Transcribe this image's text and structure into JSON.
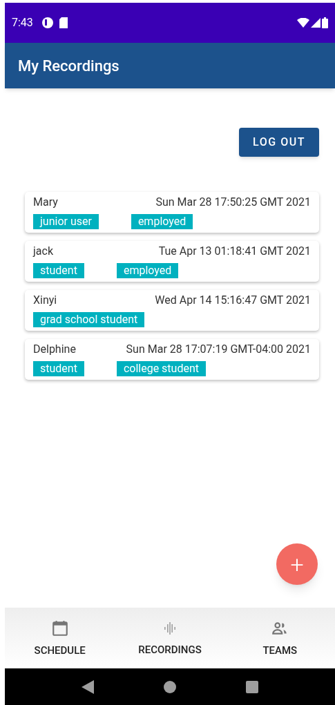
{
  "status_bar": {
    "time": "7:43"
  },
  "app_bar": {
    "title": "My Recordings"
  },
  "logout_button": {
    "label": "LOG OUT"
  },
  "recordings": [
    {
      "name": "Mary",
      "date": "Sun Mar 28 17:50:25 GMT 2021",
      "tags": [
        "junior user",
        "employed"
      ]
    },
    {
      "name": "jack",
      "date": "Tue Apr 13 01:18:41 GMT 2021",
      "tags": [
        "student",
        "employed"
      ]
    },
    {
      "name": "Xinyi",
      "date": "Wed Apr 14 15:16:47 GMT 2021",
      "tags": [
        "grad school student"
      ]
    },
    {
      "name": "Delphine",
      "date": "Sun Mar 28 17:07:19 GMT-04:00 2021",
      "tags": [
        "student",
        "college student"
      ]
    }
  ],
  "fab": {
    "label": "+"
  },
  "bottom_nav": [
    {
      "kind": "calendar",
      "label": "SCHEDULE"
    },
    {
      "kind": "audio",
      "label": "RECORDINGS"
    },
    {
      "kind": "people",
      "label": "TEAMS"
    }
  ]
}
